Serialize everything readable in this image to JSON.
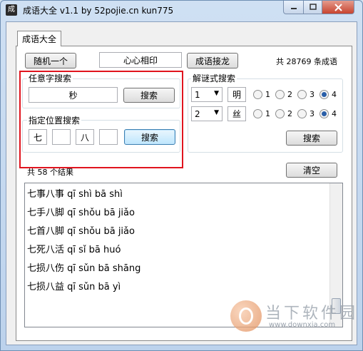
{
  "window": {
    "title": "成语大全 v1.1 by 52pojie.cn kun775",
    "icon_glyph": "成"
  },
  "tabs": [
    {
      "label": "成语大全"
    }
  ],
  "toolbar": {
    "random_label": "随机一个",
    "current_idiom": "心心相印",
    "chain_label": "成语接龙",
    "count_text": "共 28769 条成语"
  },
  "any_char_search": {
    "title": "任意字搜索",
    "value": "秒",
    "button": "搜索"
  },
  "position_search": {
    "title": "指定位置搜索",
    "slots": [
      "七",
      "",
      "八",
      ""
    ],
    "button": "搜索"
  },
  "riddle_search": {
    "title": "解谜式搜索",
    "rows": [
      {
        "pos": "1",
        "char": "明",
        "options": [
          "1",
          "2",
          "3",
          "4"
        ],
        "selected": "4"
      },
      {
        "pos": "2",
        "char": "丝",
        "options": [
          "1",
          "2",
          "3",
          "4"
        ],
        "selected": "4"
      }
    ],
    "button": "搜索"
  },
  "results": {
    "summary": "共 58 个结果",
    "clear_label": "清空",
    "items": [
      "七事八事 qī shì bā shì",
      "七手八脚 qī shǒu bā jiǎo",
      "七首八脚 qī shǒu bā jiǎo",
      "七死八活 qī sǐ bā huó",
      "七损八伤 qī sǔn bā shāng",
      "七损八益 qī sǔn bā yì"
    ]
  },
  "highlight_color": "#e0141e",
  "watermark": {
    "text": "当下软件园",
    "url": "www.downxia.com"
  }
}
